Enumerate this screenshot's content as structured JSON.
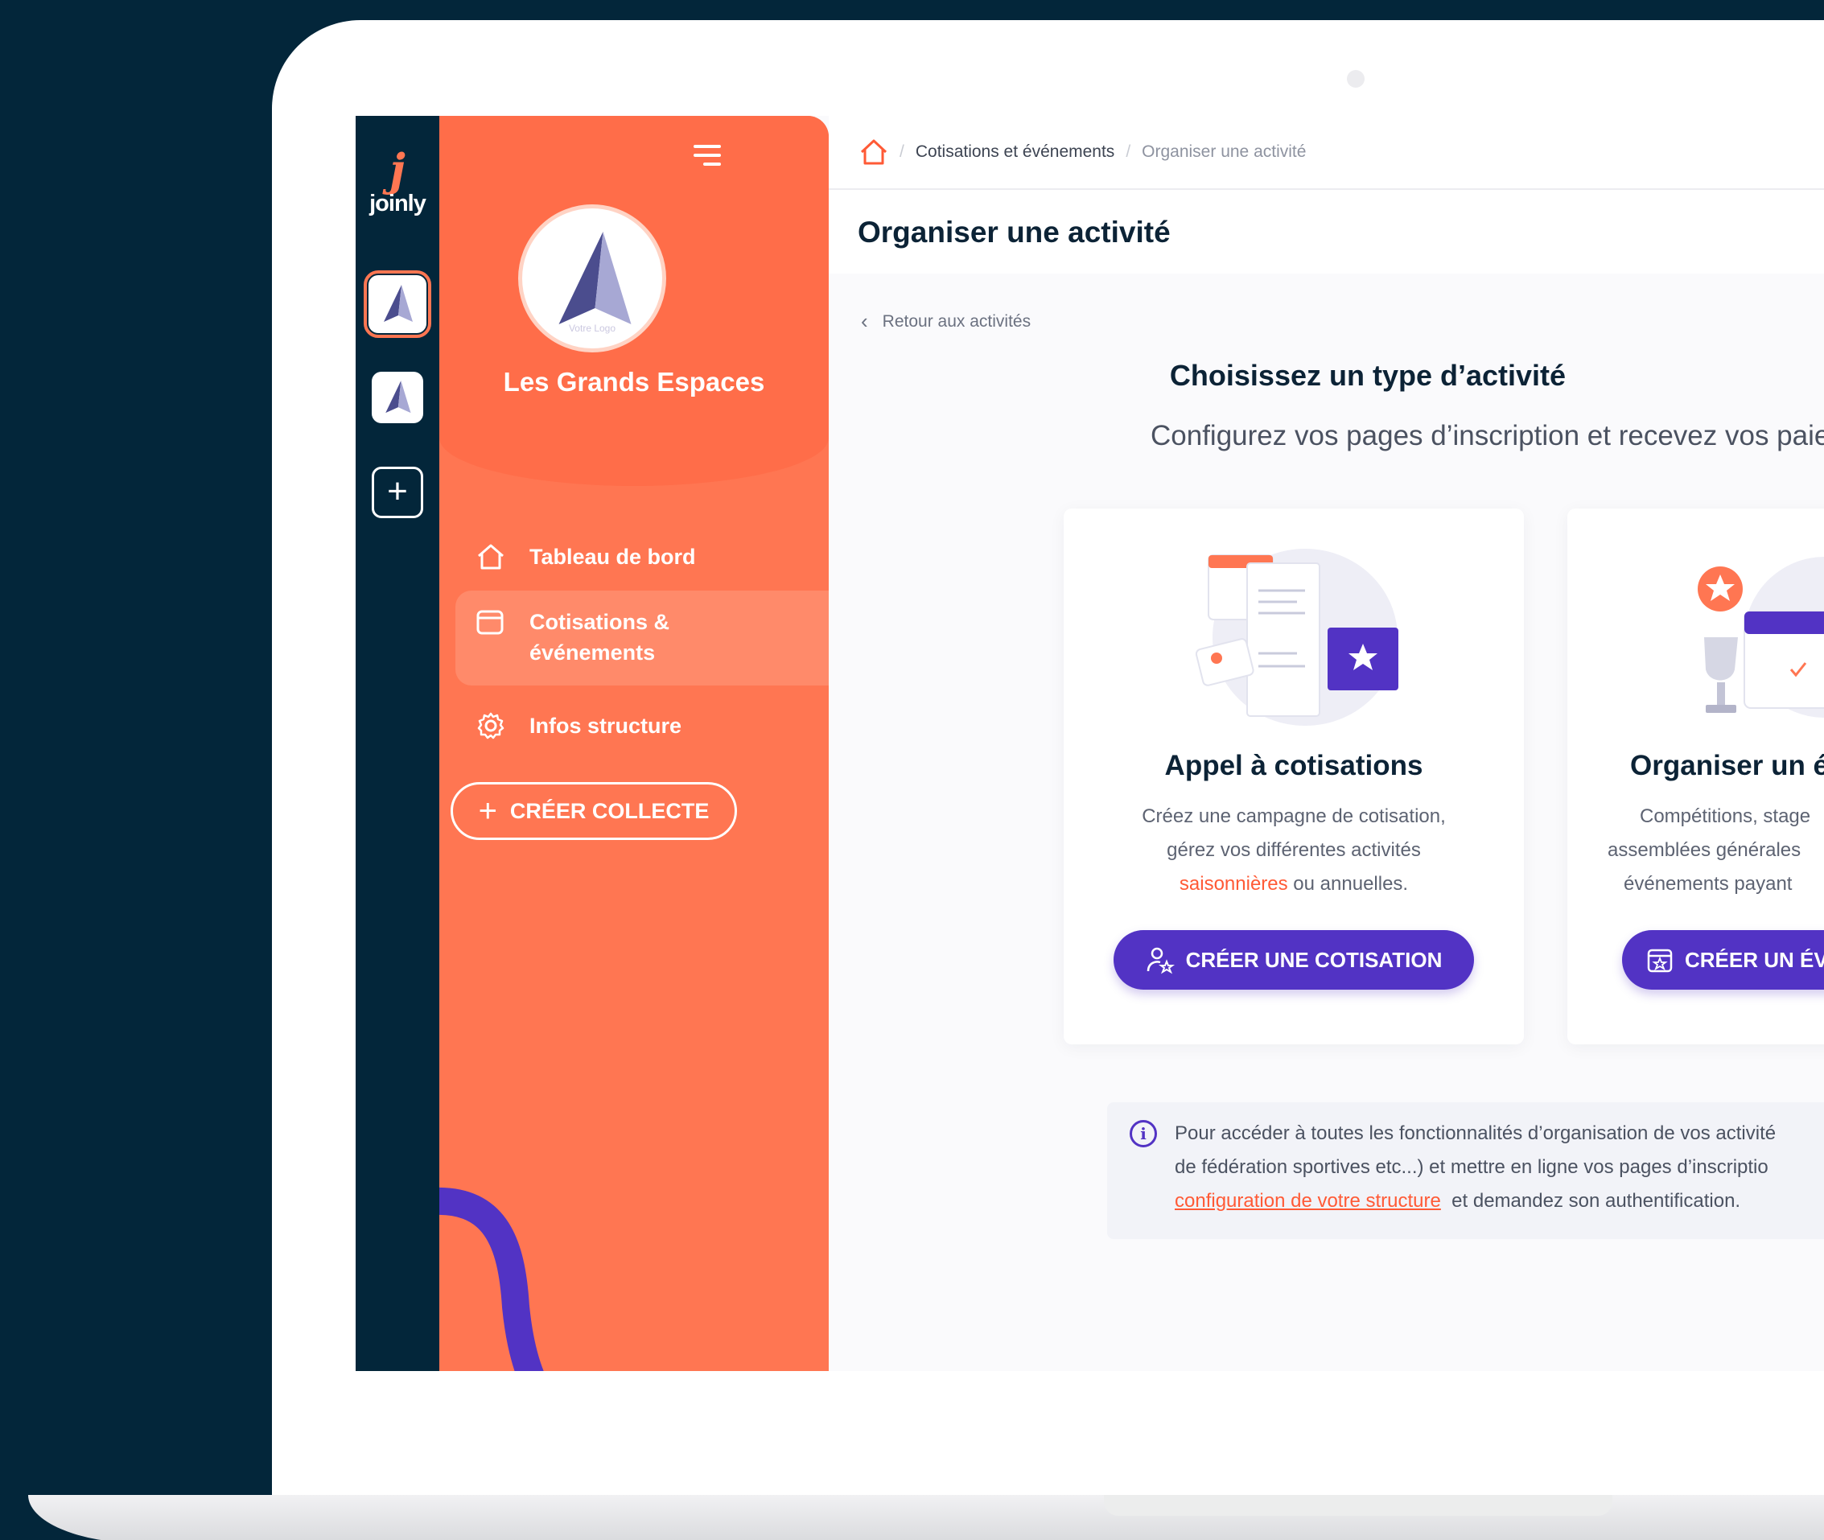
{
  "brand": {
    "logo_letter": "j",
    "logo_text": "joinly",
    "accent": "#ff7652",
    "purple": "#5233c4",
    "dark": "#03263a"
  },
  "org": {
    "name": "Les Grands Espaces",
    "logo_caption": "Votre Logo"
  },
  "sidebar": {
    "items": [
      {
        "label": "Tableau de bord",
        "icon": "home-icon"
      },
      {
        "label": "Cotisations &",
        "label2": "événements",
        "icon": "calendar-icon"
      },
      {
        "label": "Infos structure",
        "icon": "gear-icon"
      }
    ],
    "create_label": "CRÉER COLLECTE"
  },
  "breadcrumb": {
    "items": [
      "Cotisations et événements",
      "Organiser une activité"
    ]
  },
  "page": {
    "title": "Organiser une activité",
    "back_label": "Retour aux activités",
    "section_title": "Choisissez un type d’activité",
    "section_subtitle": "Configurez vos pages d’inscription et recevez vos paien"
  },
  "cards": [
    {
      "title": "Appel à cotisations",
      "desc_line1": "Créez une campagne de cotisation,",
      "desc_line2": "gérez vos différentes activités",
      "desc_highlight": "saisonnières",
      "desc_line3_rest": " ou annuelles.",
      "button": "CRÉER UNE COTISATION"
    },
    {
      "title": "Organiser un é",
      "desc_line1": "Compétitions, stage",
      "desc_line2": "assemblées générales",
      "desc_line3": "événements payant",
      "button": "CRÉER UN ÉV"
    }
  ],
  "notice": {
    "line1": "Pour accéder à toutes les fonctionnalités d’organisation de vos activité",
    "line2": "de fédération sportives etc...) et mettre en ligne vos pages d’inscriptio",
    "link": "configuration de votre structure",
    "line3_rest": "  et demandez son authentification."
  }
}
